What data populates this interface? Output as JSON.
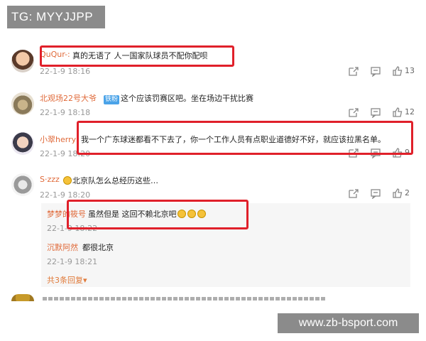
{
  "overlay": {
    "tg_label": "TG: MYYJJPP",
    "watermark": "www.zb-bsport.com"
  },
  "comments": [
    {
      "user": "QuQur-:",
      "text": "真的无语了 人一国家队球员不配你配呗",
      "date": "22-1-9 18:16",
      "likes": "13",
      "avatar_icon": "avatar-icon"
    },
    {
      "user": "北观场22号大爷",
      "badge": "铁粉",
      "text": "这个应该罚赛区吧。坐在场边干扰比赛",
      "date": "22-1-9 18:18",
      "likes": "12",
      "avatar_icon": "avatar-icon"
    },
    {
      "user": "小翠herry",
      "text": "我一个广东球迷都看不下去了，你一个工作人员有点职业道德好不好，就应该拉黑名单。",
      "date": "22-1-9 18:20",
      "likes": "9",
      "avatar_icon": "avatar-icon"
    },
    {
      "user": "S·zzz",
      "text": "北京队怎么总经历这些…",
      "date": "22-1-9 18:20",
      "likes": "2",
      "avatar_icon": "avatar-icon"
    }
  ],
  "replies": [
    {
      "user": "梦梦的筱号",
      "text": "虽然但是 这回不赖北京吧",
      "date": "22-1-9 18:22"
    },
    {
      "user": "沉默阿然",
      "text": "都很北京",
      "date": "22-1-9 18:21"
    }
  ],
  "more_replies_label": "共3条回复",
  "colors": {
    "highlight_border": "#e0202a",
    "username": "#e06a3a",
    "fan_badge": "#4aa3e8"
  }
}
